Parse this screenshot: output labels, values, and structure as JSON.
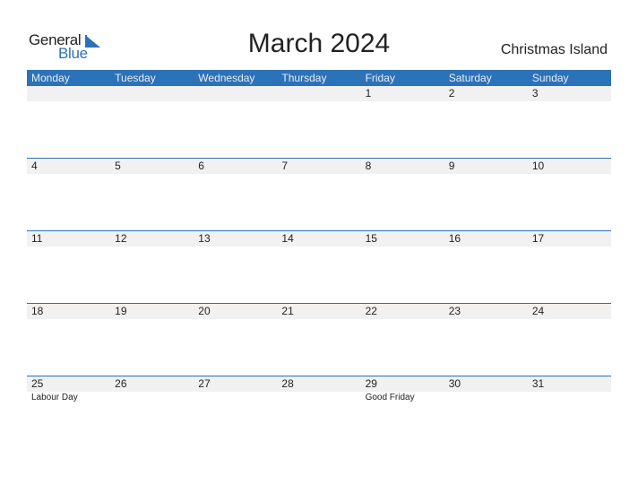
{
  "logo": {
    "word1": "General",
    "word2": "Blue"
  },
  "title": "March 2024",
  "country": "Christmas Island",
  "colors": {
    "accent": "#2c72b8",
    "row_bg": "#f1f1f1"
  },
  "weekdays": [
    "Monday",
    "Tuesday",
    "Wednesday",
    "Thursday",
    "Friday",
    "Saturday",
    "Sunday"
  ],
  "weeks": [
    {
      "days": [
        "",
        "",
        "",
        "",
        "1",
        "2",
        "3"
      ],
      "events": [
        "",
        "",
        "",
        "",
        "",
        "",
        ""
      ]
    },
    {
      "days": [
        "4",
        "5",
        "6",
        "7",
        "8",
        "9",
        "10"
      ],
      "events": [
        "",
        "",
        "",
        "",
        "",
        "",
        ""
      ]
    },
    {
      "days": [
        "11",
        "12",
        "13",
        "14",
        "15",
        "16",
        "17"
      ],
      "events": [
        "",
        "",
        "",
        "",
        "",
        "",
        ""
      ]
    },
    {
      "days": [
        "18",
        "19",
        "20",
        "21",
        "22",
        "23",
        "24"
      ],
      "events": [
        "",
        "",
        "",
        "",
        "",
        "",
        ""
      ]
    },
    {
      "days": [
        "25",
        "26",
        "27",
        "28",
        "29",
        "30",
        "31"
      ],
      "events": [
        "Labour Day",
        "",
        "",
        "",
        "Good Friday",
        "",
        ""
      ]
    }
  ]
}
